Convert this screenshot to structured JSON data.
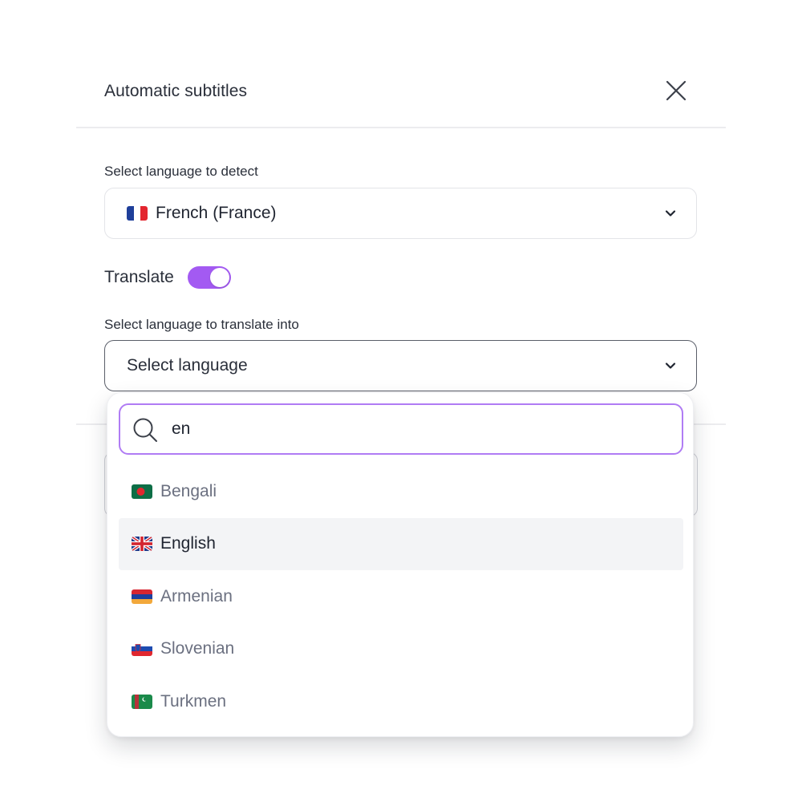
{
  "modal": {
    "title": "Automatic subtitles",
    "close_icon": "close-icon"
  },
  "detect": {
    "label": "Select language to detect",
    "selected": "French (France)",
    "flag": "flag-france"
  },
  "translate": {
    "label": "Translate",
    "enabled": true,
    "toggle_color": "#a35af2"
  },
  "translate_into": {
    "label": "Select language to translate into",
    "placeholder": "Select language"
  },
  "dropdown": {
    "search_value": "en",
    "search_icon": "search-icon",
    "focus_color": "#b07cf4",
    "options": [
      {
        "label": "Bengali",
        "flag": "flag-bangladesh",
        "highlighted": false
      },
      {
        "label": "English",
        "flag": "flag-uk",
        "highlighted": true
      },
      {
        "label": "Armenian",
        "flag": "flag-armenia",
        "highlighted": false
      },
      {
        "label": "Slovenian",
        "flag": "flag-slovenia",
        "highlighted": false
      },
      {
        "label": "Turkmen",
        "flag": "flag-turkmenistan",
        "highlighted": false
      }
    ]
  }
}
